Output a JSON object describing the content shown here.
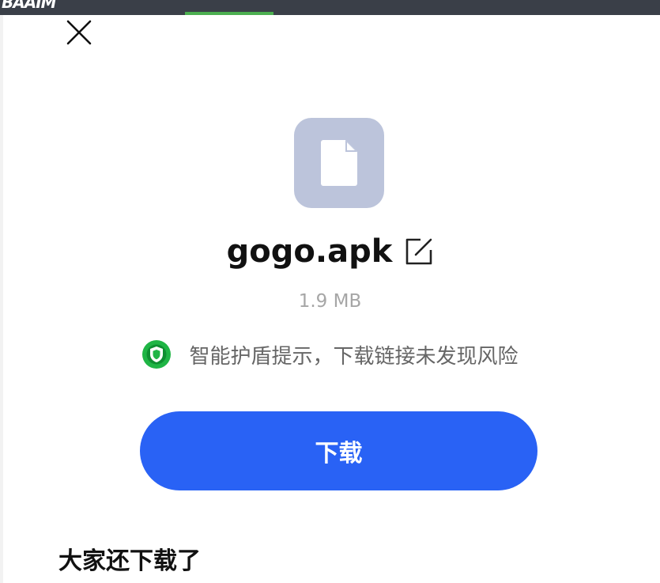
{
  "header": {
    "logo_text": "BAAIM"
  },
  "file": {
    "name": "gogo.apk",
    "size": "1.9 MB",
    "icon": "file-icon"
  },
  "security": {
    "message": "智能护盾提示，下载链接未发现风险",
    "icon": "shield-icon",
    "color": "#1fb545"
  },
  "actions": {
    "download_label": "下载",
    "download_color": "#2962f5"
  },
  "recommend": {
    "title": "大家还下载了"
  },
  "icons": {
    "close": "close-icon",
    "edit": "edit-icon"
  }
}
